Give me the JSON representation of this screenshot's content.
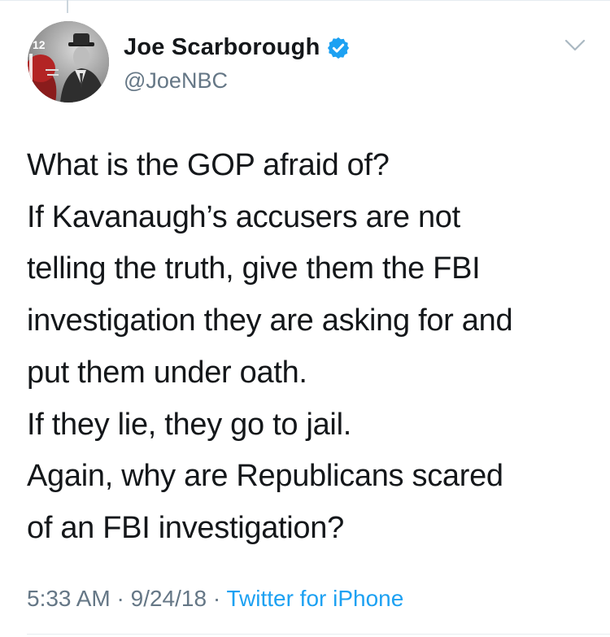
{
  "tweet": {
    "author": {
      "display_name": "Joe Scarborough",
      "handle": "@JoeNBC",
      "verified": true,
      "avatar_icon": "profile-photo",
      "avatar_jersey_number": "12"
    },
    "body_lines": [
      "What is the GOP afraid of?",
      "If Kavanaugh’s accusers are not",
      "telling the truth, give them the FBI",
      "investigation they are asking for and",
      "put them under oath.",
      "If they lie, they go to jail.",
      "Again, why are Republicans scared",
      "of an FBI investigation?"
    ],
    "time": "5:33 AM",
    "separator": " · ",
    "date": "9/24/18",
    "source": "Twitter for iPhone"
  },
  "colors": {
    "text": "#14171a",
    "secondary": "#657786",
    "link": "#1da1f2",
    "verified_badge": "#1da1f2",
    "divider": "#e6ecf0"
  }
}
